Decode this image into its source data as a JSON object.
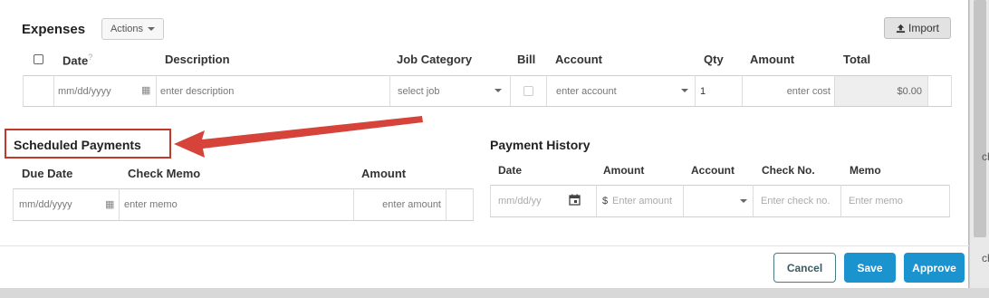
{
  "expenses": {
    "title": "Expenses",
    "actions_label": "Actions",
    "import_label": "Import",
    "columns": {
      "date": "Date",
      "date_help": "?",
      "description": "Description",
      "job_category": "Job Category",
      "bill": "Bill",
      "account": "Account",
      "qty": "Qty",
      "amount": "Amount",
      "total": "Total"
    },
    "row": {
      "date_placeholder": "mm/dd/yyyy",
      "description_placeholder": "enter description",
      "job_placeholder": "select job",
      "account_placeholder": "enter account",
      "qty_value": "1",
      "amount_placeholder": "enter cost",
      "total_value": "$0.00"
    }
  },
  "scheduled_payments": {
    "title": "Scheduled Payments",
    "columns": {
      "due_date": "Due Date",
      "check_memo": "Check Memo",
      "amount": "Amount"
    },
    "row": {
      "date_placeholder": "mm/dd/yyyy",
      "memo_placeholder": "enter memo",
      "amount_placeholder": "enter amount"
    }
  },
  "payment_history": {
    "title": "Payment History",
    "columns": {
      "date": "Date",
      "amount": "Amount",
      "account": "Account",
      "check_no": "Check No.",
      "memo": "Memo"
    },
    "row": {
      "date_placeholder": "mm/dd/yy",
      "currency": "$",
      "amount_placeholder": "Enter amount",
      "check_placeholder": "Enter check no.",
      "memo_placeholder": "Enter memo"
    }
  },
  "footer": {
    "cancel_label": "Cancel",
    "save_label": "Save",
    "approve_label": "Approve"
  },
  "background_edge_text": "ch",
  "colors": {
    "primary": "#1a93cf",
    "cancel_border": "#4a7a84",
    "annotation": "#c0392b"
  }
}
